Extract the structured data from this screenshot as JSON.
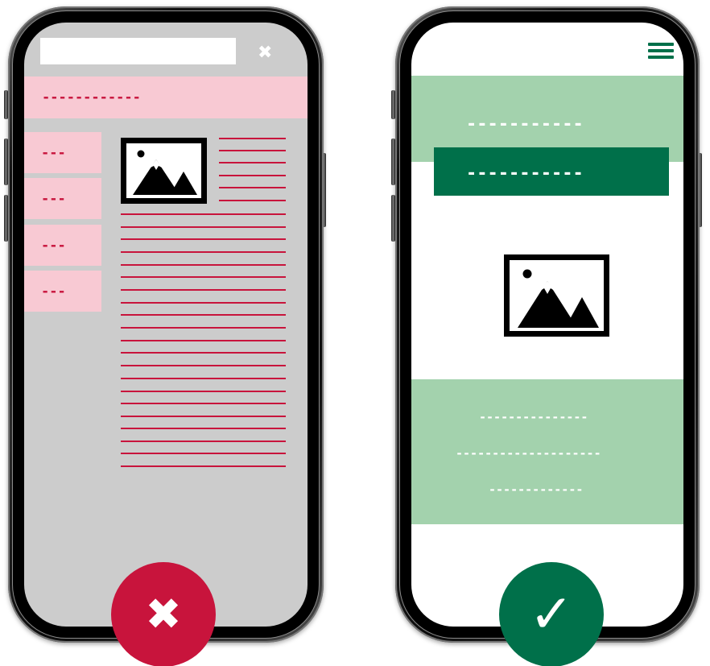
{
  "bad_example": {
    "close_icon": "✖",
    "banner_text": "------------",
    "nav_items": [
      {
        "label": "---"
      },
      {
        "label": "---"
      },
      {
        "label": "---"
      },
      {
        "label": "---"
      }
    ],
    "image_icon": "mountain-image-icon",
    "text_line_color": "#c8143c",
    "background_color": "#cccccc",
    "accent_light": "#f8c9d3"
  },
  "good_example": {
    "menu_icon": "hamburger-menu-icon",
    "hero_title": "-----------",
    "hero_button": "-----------",
    "image_icon": "mountain-image-icon",
    "footer_lines": [
      "---------------",
      "--------------------",
      "-------------"
    ],
    "accent_dark": "#00704a",
    "accent_light": "#a3d2ad"
  },
  "verdicts": {
    "bad_symbol": "✖",
    "good_symbol": "✓",
    "bad_color": "#c8143c",
    "good_color": "#00704a"
  }
}
